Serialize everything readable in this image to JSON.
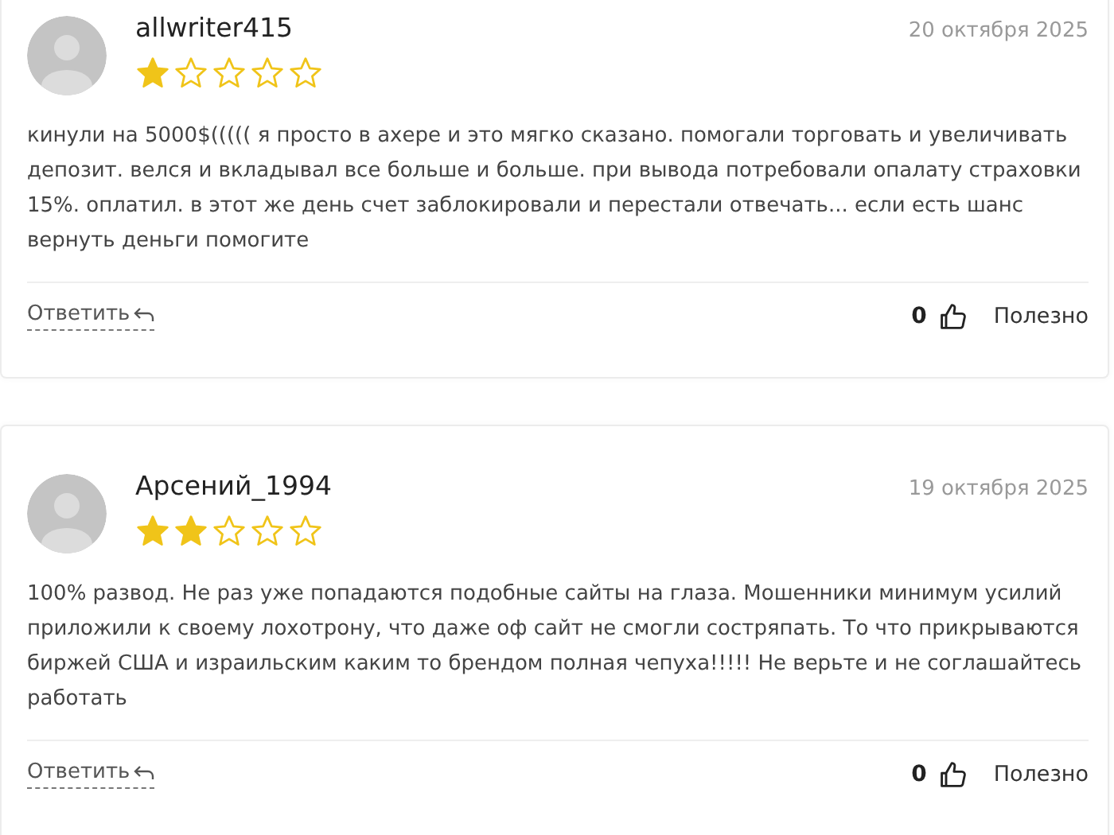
{
  "reviews": [
    {
      "author": "allwriter415",
      "date": "20 октября 2025",
      "stars": 1,
      "text": "кинули на 5000$((((( я просто в ахере и это мягко сказано. помогали торговать и увеличивать депозит. велся и вкладывал все больше и больше. при вывода потребовали опалату страховки 15%. оплатил. в этот же день счет заблокировали и перестали отвечать... если есть шанс вернуть деньги помогите",
      "reply": "Ответить",
      "likes": "0",
      "helpful": "Полезно"
    },
    {
      "author": "Арсений_1994",
      "date": "19 октября 2025",
      "stars": 2,
      "text": "100% развод. Не раз уже попадаются подобные сайты на глаза. Мошенники минимум усилий приложили к своему лохотрону, что даже оф сайт не смогли состряпать. То что прикрываются биржей США и израильским каким то брендом полная чепуха!!!!! Не верьте и не соглашайтесь работать",
      "reply": "Ответить",
      "likes": "0",
      "helpful": "Полезно"
    }
  ]
}
